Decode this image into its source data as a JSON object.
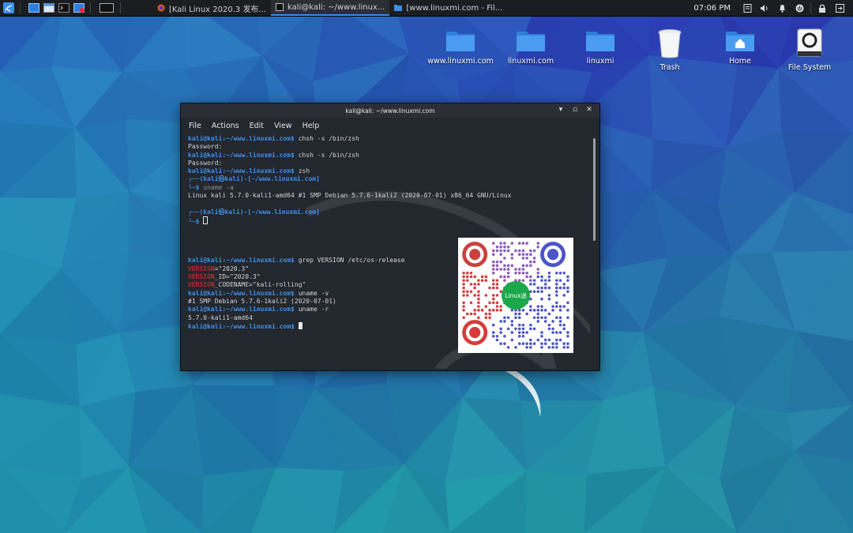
{
  "panel": {
    "tasks": [
      {
        "label": "[Kali Linux 2020.3 发布..."
      },
      {
        "label": "kali@kali: ~/www.linux..."
      },
      {
        "label": "[www.linuxmi.com - Fil..."
      }
    ],
    "clock": "07:06 PM",
    "tray_icons": [
      "notes-icon",
      "volume-icon",
      "notification-bell-icon",
      "power-icon",
      "lock-icon",
      "logout-icon"
    ]
  },
  "desktop_icons": [
    {
      "label": "www.linuxmi.com",
      "icon": "folder-icon"
    },
    {
      "label": "linuxmi.com",
      "icon": "folder-icon"
    },
    {
      "label": "linuxmi",
      "icon": "folder-icon"
    },
    {
      "label": "Trash",
      "icon": "trash-icon"
    },
    {
      "label": "Home",
      "icon": "home-folder-icon"
    },
    {
      "label": "File System",
      "icon": "drive-icon"
    }
  ],
  "terminal": {
    "title": "kali@kali: ~/www.linuxmi.com",
    "menu": [
      "File",
      "Actions",
      "Edit",
      "View",
      "Help"
    ],
    "prompt_user": "kali@kali",
    "prompt_path": ":~/www.linuxmi.com$",
    "zsh_prompt_top": "┌──(kali㉿kali)-[~/www.linuxmi.com]",
    "zsh_prompt_bottom": "└─$",
    "cmd_chsh": "chsh -s /bin/zsh",
    "password": "Password:",
    "cmd_zsh": "zsh",
    "cmd_uname_a": "uname -a",
    "uname_a_output": "Linux kali 5.7.0-kali1-amd64 #1 SMP Debian 5.7.6-1kali2 (2020-07-01) x86_64 GNU/Linux",
    "cmd_grep": "grep VERSION /etc/os-release",
    "version_key": "VERSION",
    "version_val": "=\"2020.3\"",
    "version_id_rest": "_ID=\"2020.3\"",
    "version_codename_rest": "_CODENAME=\"kali-rolling\"",
    "cmd_uname_v": "uname -v",
    "uname_v_output": "#1 SMP Debian 5.7.6-1kali2 (2020-07-01)",
    "cmd_uname_r": "uname -r",
    "uname_r_output": "5.7.0-kali1-amd64"
  },
  "qr_badge": "Linux迷",
  "colors": {
    "prompt": "#3f8fe6",
    "highlight": "#ef2b2b",
    "terminal_bg": "#23272e",
    "panel_bg": "#1b1d20",
    "folder": "#3b8ce0"
  }
}
